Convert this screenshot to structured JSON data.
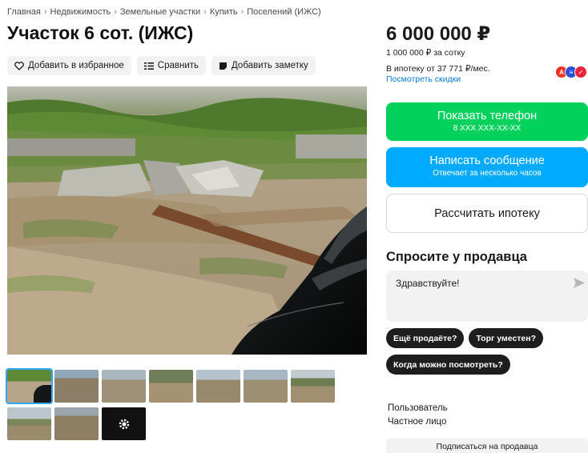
{
  "breadcrumb": {
    "items": [
      "Главная",
      "Недвижимость",
      "Земельные участки",
      "Купить",
      "Поселений (ИЖС)"
    ],
    "separator": "›"
  },
  "listing": {
    "title": "Участок 6 сот. (ИЖС)"
  },
  "actions": {
    "favorite_label": "Добавить в избранное",
    "compare_label": "Сравнить",
    "note_label": "Добавить заметку"
  },
  "price": {
    "total": "6 000 000 ₽",
    "per_sotka": "1 000 000 ₽ за сотку",
    "mortgage": "В ипотеку от 37 771 ₽/мес.",
    "discounts_link": "Посмотреть скидки"
  },
  "banks": [
    {
      "icon": "bank-alfa-icon",
      "letter": "А",
      "color": "#ef3124"
    },
    {
      "icon": "bank-blue-icon",
      "letter": "≡",
      "color": "#2b4fd6"
    },
    {
      "icon": "bank-red-icon",
      "letter": "✓",
      "color": "#e8253b"
    }
  ],
  "contact": {
    "phone_label": "Показать телефон",
    "phone_masked": "8 XXX XXX-XX-XX",
    "message_label": "Написать сообщение",
    "message_sub": "Отвечает за несколько часов",
    "mortgage_calc_label": "Рассчитать ипотеку"
  },
  "ask": {
    "title": "Спросите у продавца",
    "input_value": "Здравствуйте!",
    "chips": [
      "Ещё продаёте?",
      "Торг уместен?",
      "Когда можно посмотреть?"
    ]
  },
  "seller": {
    "type": "Пользователь",
    "kind": "Частное лицо",
    "subscribe_label": "Подписаться на продавца"
  },
  "colors": {
    "phone_button": "#02d15c",
    "message_button": "#00aaff",
    "link": "#0a78d1",
    "active_thumb_outline": "#2fa8f5"
  },
  "gallery": {
    "thumbnail_count": 10,
    "active_index": 0,
    "more_icon": "gear-icon"
  }
}
